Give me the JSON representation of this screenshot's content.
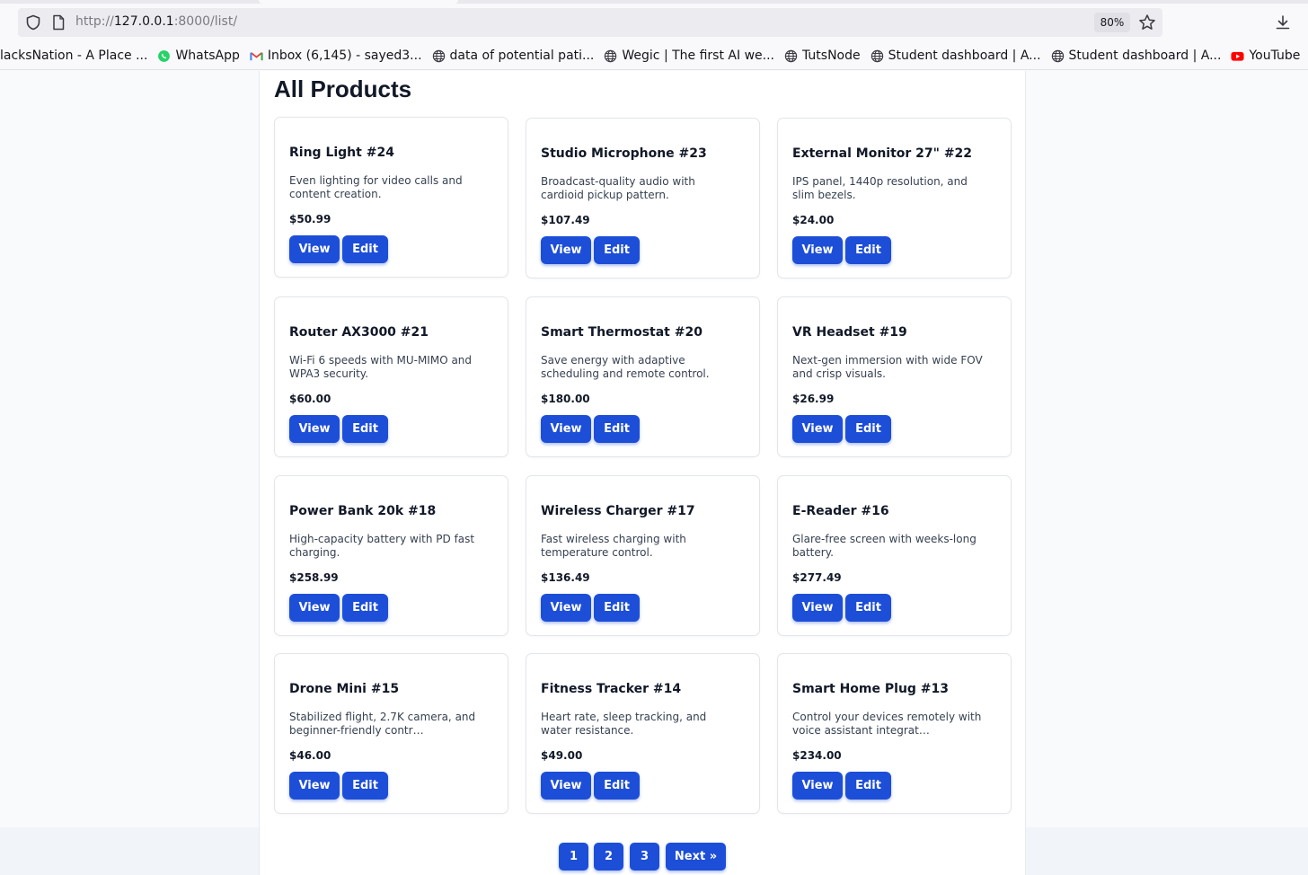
{
  "browser": {
    "url_prefix": "http://",
    "url_host": "127.0.0.1",
    "url_rest": ":8000/list/",
    "zoom": "80%",
    "bookmarks": [
      {
        "label": "lacksNation - A Place ...",
        "icon": "globe-icon"
      },
      {
        "label": "WhatsApp",
        "icon": "whatsapp-icon"
      },
      {
        "label": "Inbox (6,145) - sayed3...",
        "icon": "gmail-icon"
      },
      {
        "label": "data of potential pati...",
        "icon": "globe-icon"
      },
      {
        "label": "Wegic | The first AI we...",
        "icon": "globe-icon"
      },
      {
        "label": "TutsNode",
        "icon": "globe-icon"
      },
      {
        "label": "Student dashboard | A...",
        "icon": "globe-icon"
      },
      {
        "label": "Student dashboard | A...",
        "icon": "globe-icon"
      },
      {
        "label": "YouTube",
        "icon": "youtube-icon"
      }
    ]
  },
  "page": {
    "title": "All Products",
    "view_label": "View",
    "edit_label": "Edit",
    "accent_color": "#1d4ed8"
  },
  "products": [
    {
      "name": "Ring Light #24",
      "description": "Even lighting for video calls and content creation.",
      "price": "$50.99"
    },
    {
      "name": "Studio Microphone #23",
      "description": "Broadcast-quality audio with cardioid pickup pattern.",
      "price": "$107.49"
    },
    {
      "name": "External Monitor 27\" #22",
      "description": "IPS panel, 1440p resolution, and slim bezels.",
      "price": "$24.00"
    },
    {
      "name": "Router AX3000 #21",
      "description": "Wi-Fi 6 speeds with MU-MIMO and WPA3 security.",
      "price": "$60.00"
    },
    {
      "name": "Smart Thermostat #20",
      "description": "Save energy with adaptive scheduling and remote control.",
      "price": "$180.00"
    },
    {
      "name": "VR Headset #19",
      "description": "Next-gen immersion with wide FOV and crisp visuals.",
      "price": "$26.99"
    },
    {
      "name": "Power Bank 20k #18",
      "description": "High-capacity battery with PD fast charging.",
      "price": "$258.99"
    },
    {
      "name": "Wireless Charger #17",
      "description": "Fast wireless charging with temperature control.",
      "price": "$136.49"
    },
    {
      "name": "E-Reader #16",
      "description": "Glare-free screen with weeks-long battery.",
      "price": "$277.49"
    },
    {
      "name": "Drone Mini #15",
      "description": "Stabilized flight, 2.7K camera, and beginner-friendly contr…",
      "price": "$46.00"
    },
    {
      "name": "Fitness Tracker #14",
      "description": "Heart rate, sleep tracking, and water resistance.",
      "price": "$49.00"
    },
    {
      "name": "Smart Home Plug #13",
      "description": "Control your devices remotely with voice assistant integrat…",
      "price": "$234.00"
    }
  ],
  "pagination": {
    "pages": [
      "1",
      "2",
      "3"
    ],
    "next_label": "Next »"
  }
}
